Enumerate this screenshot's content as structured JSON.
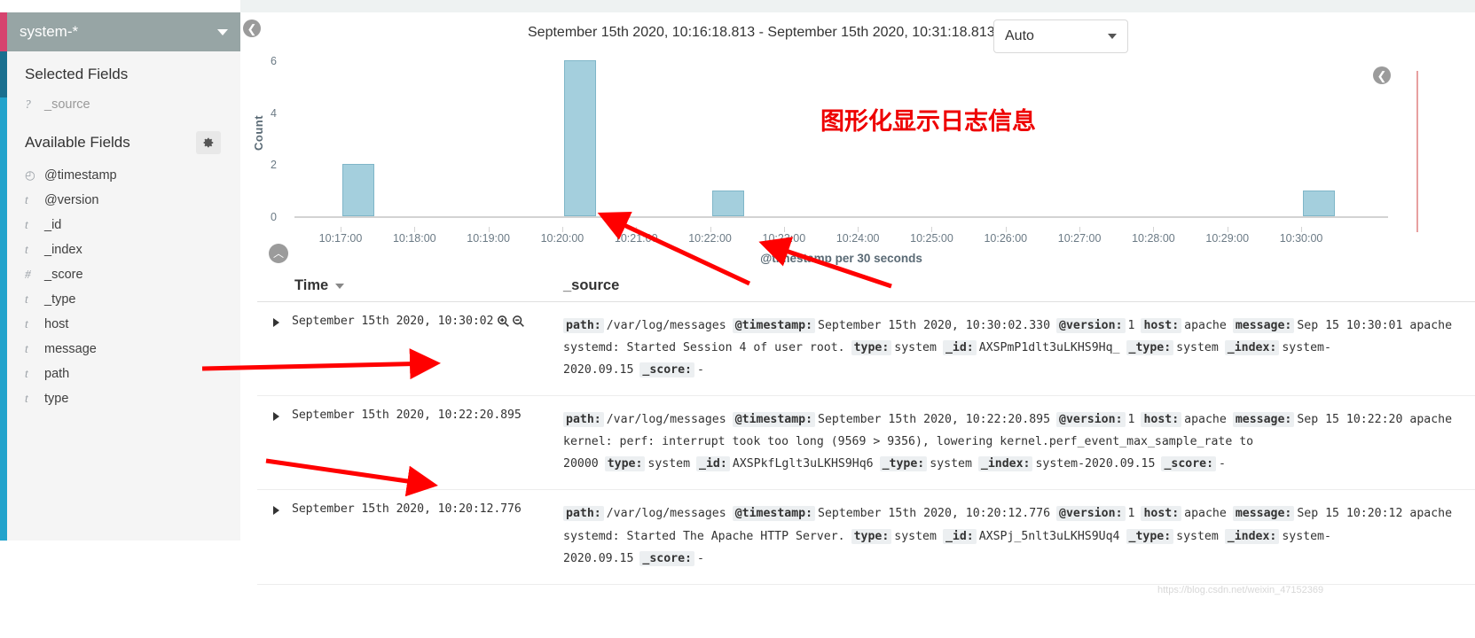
{
  "sidebar": {
    "index_pattern": "system-*",
    "selected_fields_title": "Selected Fields",
    "available_fields_title": "Available Fields",
    "selected_fields": [
      {
        "type": "?",
        "name": "_source"
      }
    ],
    "available_fields": [
      {
        "type": "clock",
        "name": "@timestamp"
      },
      {
        "type": "t",
        "name": "@version"
      },
      {
        "type": "t",
        "name": "_id"
      },
      {
        "type": "t",
        "name": "_index"
      },
      {
        "type": "#",
        "name": "_score"
      },
      {
        "type": "t",
        "name": "_type"
      },
      {
        "type": "t",
        "name": "host"
      },
      {
        "type": "t",
        "name": "message"
      },
      {
        "type": "t",
        "name": "path"
      },
      {
        "type": "t",
        "name": "type"
      }
    ]
  },
  "header": {
    "time_range": "September 15th 2020, 10:16:18.813 - September 15th 2020, 10:31:18.813 —",
    "interval_selected": "Auto"
  },
  "annotation": {
    "text": "图形化显示日志信息",
    "color": "#ee0000"
  },
  "chart_data": {
    "type": "bar",
    "title": "",
    "xlabel": "@timestamp per 30 seconds",
    "ylabel": "Count",
    "ylim": [
      0,
      6
    ],
    "yticks": [
      0,
      2,
      4,
      6
    ],
    "grid": false,
    "bar_color": "#a4cfdd",
    "bar_border_color": "#7fb6c8",
    "categories": [
      "10:17:00",
      "10:18:00",
      "10:19:00",
      "10:20:00",
      "10:21:00",
      "10:22:00",
      "10:23:00",
      "10:24:00",
      "10:25:00",
      "10:26:00",
      "10:27:00",
      "10:28:00",
      "10:29:00",
      "10:30:00"
    ],
    "xticks": [
      "10:17:00",
      "10:18:00",
      "10:19:00",
      "10:20:00",
      "10:21:00",
      "10:22:00",
      "10:23:00",
      "10:24:00",
      "10:25:00",
      "10:26:00",
      "10:27:00",
      "10:28:00",
      "10:29:00",
      "10:30:00"
    ],
    "values": [
      2,
      0,
      0,
      6,
      0,
      1,
      0,
      0,
      0,
      0,
      0,
      0,
      0,
      1
    ],
    "bars": [
      {
        "x": "10:17:00",
        "value": 2
      },
      {
        "x": "10:20:00",
        "value": 6
      },
      {
        "x": "10:22:00",
        "value": 1
      },
      {
        "x": "10:30:00",
        "value": 1
      }
    ]
  },
  "table": {
    "columns": {
      "time": "Time",
      "source": "_source"
    },
    "rows": [
      {
        "time": "September 15th 2020, 10:30:02",
        "fields": [
          {
            "key": "path:",
            "value": "/var/log/messages"
          },
          {
            "key": "@timestamp:",
            "value": "September 15th 2020, 10:30:02.330"
          },
          {
            "key": "@version:",
            "value": "1"
          },
          {
            "key": "host:",
            "value": "apache"
          },
          {
            "key": "message:",
            "value": "Sep 15 10:30:01 apache systemd: Started Session 4 of user root."
          },
          {
            "key": "type:",
            "value": "system"
          },
          {
            "key": "_id:",
            "value": "AXSPmP1dlt3uLKHS9Hq_"
          },
          {
            "key": "_type:",
            "value": "system"
          },
          {
            "key": "_index:",
            "value": "system-2020.09.15"
          },
          {
            "key": "_score:",
            "value": "-"
          }
        ]
      },
      {
        "time": "September 15th 2020, 10:22:20.895",
        "fields": [
          {
            "key": "path:",
            "value": "/var/log/messages"
          },
          {
            "key": "@timestamp:",
            "value": "September 15th 2020, 10:22:20.895"
          },
          {
            "key": "@version:",
            "value": "1"
          },
          {
            "key": "host:",
            "value": "apache"
          },
          {
            "key": "message:",
            "value": "Sep 15 10:22:20 apache kernel: perf: interrupt took too long (9569 > 9356), lowering kernel.perf_event_max_sample_rate to 20000"
          },
          {
            "key": "type:",
            "value": "system"
          },
          {
            "key": "_id:",
            "value": "AXSPkfLglt3uLKHS9Hq6"
          },
          {
            "key": "_type:",
            "value": "system"
          },
          {
            "key": "_index:",
            "value": "system-2020.09.15"
          },
          {
            "key": "_score:",
            "value": "-"
          }
        ]
      },
      {
        "time": "September 15th 2020, 10:20:12.776",
        "fields": [
          {
            "key": "path:",
            "value": "/var/log/messages"
          },
          {
            "key": "@timestamp:",
            "value": "September 15th 2020, 10:20:12.776"
          },
          {
            "key": "@version:",
            "value": "1"
          },
          {
            "key": "host:",
            "value": "apache"
          },
          {
            "key": "message:",
            "value": "Sep 15 10:20:12 apache systemd: Started The Apache HTTP Server."
          },
          {
            "key": "type:",
            "value": "system"
          },
          {
            "key": "_id:",
            "value": "AXSPj_5nlt3uLKHS9Uq4"
          },
          {
            "key": "_type:",
            "value": "system"
          },
          {
            "key": "_index:",
            "value": "system-2020.09.15"
          },
          {
            "key": "_score:",
            "value": "-"
          }
        ]
      }
    ]
  },
  "watermark": "https://blog.csdn.net/weixin_47152369"
}
